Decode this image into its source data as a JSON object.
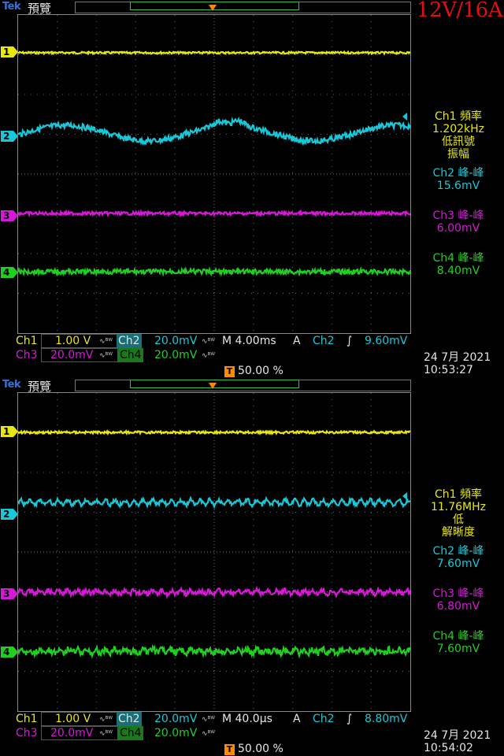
{
  "title": "12V/16A",
  "colors": {
    "ch1": "#e8e810",
    "ch2": "#18c8d8",
    "ch3": "#d818d8",
    "ch4": "#20d020",
    "trigger": "#ff8a00",
    "brand": "#3a6fd8",
    "title": "#e01010"
  },
  "panels": [
    {
      "brand": "Tek",
      "mode": "預覽",
      "trigger_marker": "T",
      "channel_markers": [
        "1",
        "2",
        "3",
        "4"
      ],
      "measurements": [
        {
          "label": "Ch1 頻率",
          "value": "1.202kHz",
          "note1": "低訊號",
          "note2": "振幅"
        },
        {
          "label": "Ch2 峰-峰",
          "value": "15.6mV"
        },
        {
          "label": "Ch3 峰-峰",
          "value": "6.00mV"
        },
        {
          "label": "Ch4 峰-峰",
          "value": "8.40mV"
        }
      ],
      "status": {
        "ch1": "Ch1",
        "ch1_scale": "1.00 V",
        "ch2": "Ch2",
        "ch2_scale": "20.0mV",
        "timebase": "M 4.00ms",
        "trig_mode": "A",
        "trig_src": "Ch2",
        "trig_slope": "∫",
        "trig_level": "9.60mV",
        "ch3": "Ch3",
        "ch3_scale": "20.0mV",
        "ch4": "Ch4",
        "ch4_scale": "20.0mV",
        "trig_pos": "50.00 %",
        "date": "24 7月  2021",
        "time": "10:53:27"
      }
    },
    {
      "brand": "Tek",
      "mode": "預覽",
      "trigger_marker": "T",
      "channel_markers": [
        "1",
        "2",
        "3",
        "4"
      ],
      "measurements": [
        {
          "label": "Ch1 頻率",
          "value": "11.76MHz",
          "note1": "低",
          "note2": "解晰度"
        },
        {
          "label": "Ch2 峰-峰",
          "value": "7.60mV"
        },
        {
          "label": "Ch3 峰-峰",
          "value": "6.80mV"
        },
        {
          "label": "Ch4 峰-峰",
          "value": "7.60mV"
        }
      ],
      "status": {
        "ch1": "Ch1",
        "ch1_scale": "1.00 V",
        "ch2": "Ch2",
        "ch2_scale": "20.0mV",
        "timebase": "M 40.0µs",
        "trig_mode": "A",
        "trig_src": "Ch2",
        "trig_slope": "∫",
        "trig_level": "8.80mV",
        "ch3": "Ch3",
        "ch3_scale": "20.0mV",
        "ch4": "Ch4",
        "ch4_scale": "20.0mV",
        "trig_pos": "50.00 %",
        "date": "24 7月  2021",
        "time": "10:54:02"
      }
    }
  ]
}
